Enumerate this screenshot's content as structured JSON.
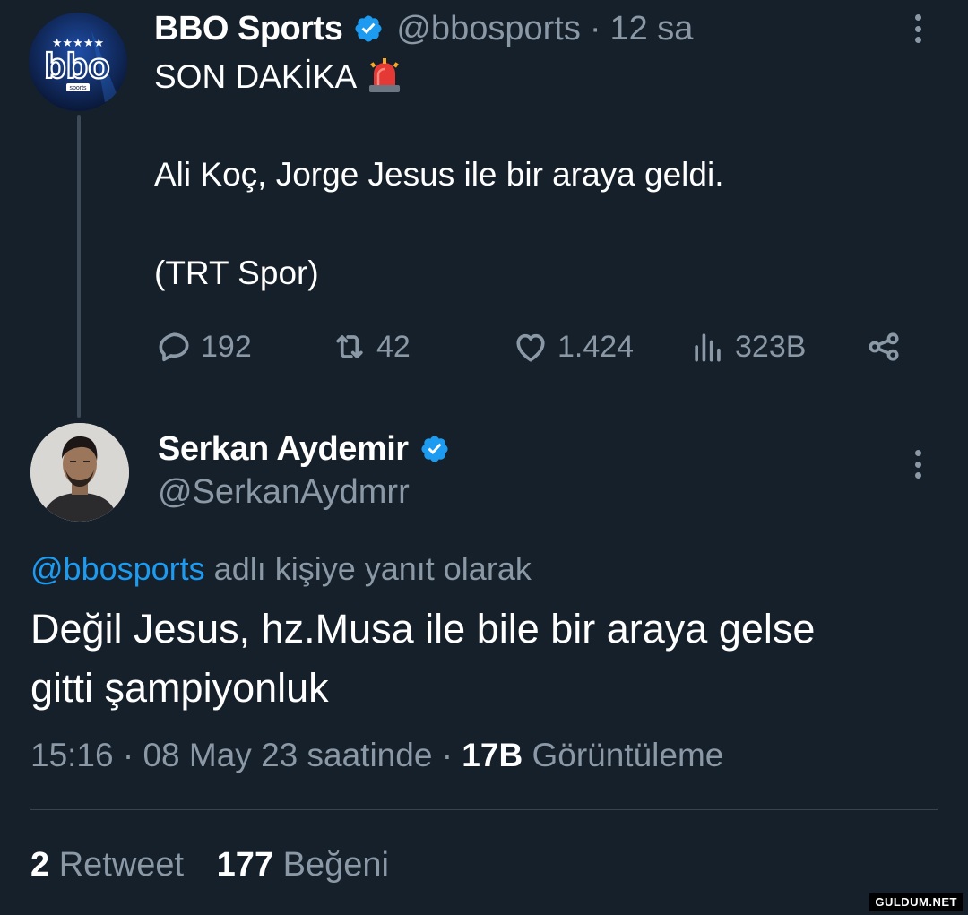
{
  "parent_tweet": {
    "author_name": "BBO Sports",
    "handle": "@bbosports",
    "separator": "·",
    "time": "12 sa",
    "avatar": {
      "icon": "bbo-sports-logo",
      "logo_text": "bbo",
      "logo_subtext": "sports"
    },
    "text_line1": "SON DAKİKA",
    "text_emoji_icon": "siren-icon",
    "text_line2": "Ali Koç, Jorge Jesus ile bir araya geldi.",
    "text_line3": "(TRT Spor)",
    "actions": {
      "replies": "192",
      "retweets": "42",
      "likes": "1.424",
      "views": "323B"
    }
  },
  "reply_tweet": {
    "author_name": "Serkan Aydemir",
    "handle": "@SerkanAydmrr",
    "reply_to_handle": "@bbosports",
    "reply_to_suffix": "adlı kişiye yanıt olarak",
    "text_line1": "Değil Jesus, hz.Musa ile bile bir araya gelse",
    "text_line2": "gitti şampiyonluk",
    "timestamp": "15:16 · 08 May 23 saatinde ·",
    "views_count": "17B",
    "views_label": "Görüntüleme",
    "retweet_count": "2",
    "retweet_label": "Retweet",
    "like_count": "177",
    "like_label": "Beğeni"
  },
  "watermark": "GULDUM.NET",
  "colors": {
    "background": "#15202b",
    "text": "#ffffff",
    "muted": "#8b98a5",
    "accent": "#1d9bf0",
    "divider": "#38444d"
  }
}
